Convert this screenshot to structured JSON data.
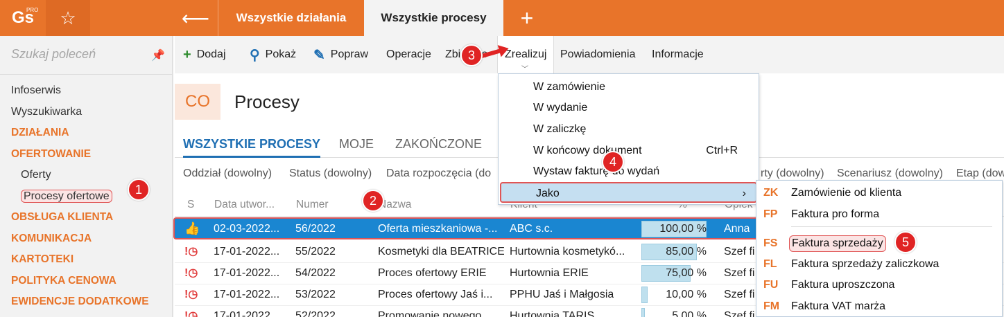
{
  "topbar": {
    "logo": "Gs",
    "logo_badge": "PRO",
    "tabs": [
      "Wszystkie działania",
      "Wszystkie procesy"
    ]
  },
  "sidebar": {
    "search_placeholder": "Szukaj poleceń",
    "items": [
      {
        "label": "Infoserwis",
        "type": "link"
      },
      {
        "label": "Wyszukiwarka",
        "type": "link"
      },
      {
        "label": "DZIAŁANIA",
        "type": "section"
      },
      {
        "label": "OFERTOWANIE",
        "type": "section"
      },
      {
        "label": "Oferty",
        "type": "sub"
      },
      {
        "label": "Procesy ofertowe",
        "type": "sub-active"
      },
      {
        "label": "OBSŁUGA KLIENTA",
        "type": "section"
      },
      {
        "label": "KOMUNIKACJA",
        "type": "section"
      },
      {
        "label": "KARTOTEKI",
        "type": "section"
      },
      {
        "label": "POLITYKA CENOWA",
        "type": "section"
      },
      {
        "label": "EWIDENCJE DODATKOWE",
        "type": "section"
      }
    ]
  },
  "toolbar": {
    "add": "Dodaj",
    "show": "Pokaż",
    "edit": "Popraw",
    "operations": "Operacje",
    "collective": "Zbiorczo",
    "realize": "Zrealizuj",
    "notifications": "Powiadomienia",
    "info": "Informacje"
  },
  "header": {
    "badge": "CO",
    "title": "Procesy"
  },
  "tabs": [
    "WSZYSTKIE PROCESY",
    "MOJE",
    "ZAKOŃCZONE"
  ],
  "filters": [
    "Oddział (dowolny)",
    "Status (dowolny)",
    "Data rozpoczęcia (do",
    "rty (dowolny)",
    "Scenariusz (dowolny)",
    "Etap (dow"
  ],
  "table": {
    "columns": [
      "S",
      "Data utwor...",
      "Numer",
      "Nazwa",
      "Klient",
      "%",
      "Opiek"
    ],
    "rows": [
      {
        "status": "ok",
        "date": "02-03-2022...",
        "number": "56/2022",
        "name": "Oferta mieszkaniowa -...",
        "client": "ABC s.c.",
        "percent": 100,
        "percent_text": "100,00 %",
        "owner": "Anna"
      },
      {
        "status": "alert",
        "date": "17-01-2022...",
        "number": "55/2022",
        "name": "Kosmetyki dla BEATRICE",
        "client": "Hurtownia kosmetykó...",
        "percent": 85,
        "percent_text": "85,00 %",
        "owner": "Szef fi"
      },
      {
        "status": "alert",
        "date": "17-01-2022...",
        "number": "54/2022",
        "name": "Proces ofertowy ERIE",
        "client": "Hurtownia ERIE",
        "percent": 75,
        "percent_text": "75,00 %",
        "owner": "Szef fi"
      },
      {
        "status": "alert",
        "date": "17-01-2022...",
        "number": "53/2022",
        "name": "Proces ofertowy Jaś i...",
        "client": "PPHU Jaś i Małgosia",
        "percent": 10,
        "percent_text": "10,00 %",
        "owner": "Szef fi"
      },
      {
        "status": "alert",
        "date": "17-01-2022",
        "number": "52/2022",
        "name": "Promowanie nowego",
        "client": "Hurtownia TARIS",
        "percent": 5,
        "percent_text": "5,00 %",
        "owner": "Szef fi"
      }
    ]
  },
  "menu": {
    "items": [
      {
        "label": "W zamówienie",
        "shortcut": ""
      },
      {
        "label": "W wydanie",
        "shortcut": ""
      },
      {
        "label": "W zaliczkę",
        "shortcut": ""
      },
      {
        "label": "W końcowy dokument",
        "shortcut": "Ctrl+R"
      },
      {
        "label": "Wystaw fakturę do wydań",
        "shortcut": ""
      },
      {
        "label": "Jako",
        "shortcut": "›"
      }
    ]
  },
  "submenu": {
    "items": [
      {
        "code": "ZK",
        "label": "Zamówienie od klienta"
      },
      {
        "code": "FP",
        "label": "Faktura pro forma"
      },
      {
        "code": "FS",
        "label": "Faktura sprzedaży"
      },
      {
        "code": "FL",
        "label": "Faktura sprzedaży zaliczkowa"
      },
      {
        "code": "FU",
        "label": "Faktura uproszczona"
      },
      {
        "code": "FM",
        "label": "Faktura VAT marża"
      }
    ]
  },
  "markers": [
    "1",
    "2",
    "3",
    "4",
    "5"
  ],
  "colors": {
    "accent": "#e8742a",
    "selection": "#1a86d1",
    "marker": "#e02424",
    "tab_active": "#1f6fb3"
  }
}
